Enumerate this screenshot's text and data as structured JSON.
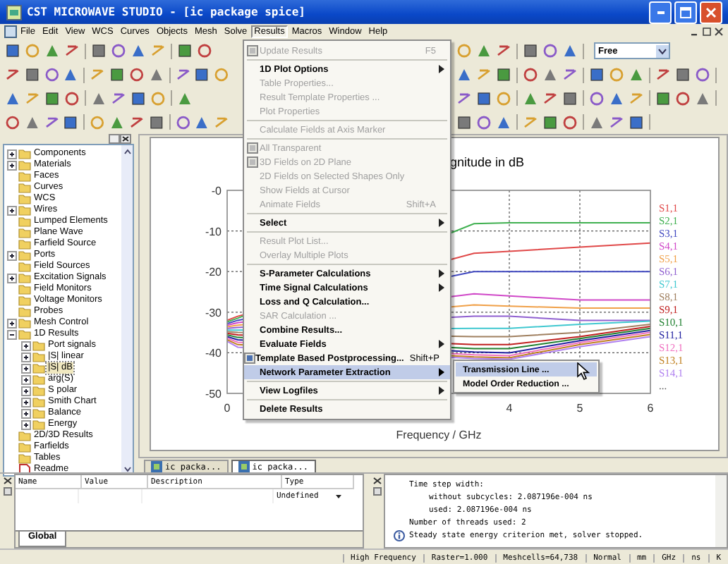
{
  "window": {
    "title": "CST MICROWAVE STUDIO - [ic package spice]"
  },
  "menu_bar": [
    {
      "label": "File",
      "selected": false
    },
    {
      "label": "Edit",
      "selected": false
    },
    {
      "label": "View",
      "selected": false
    },
    {
      "label": "WCS",
      "selected": false
    },
    {
      "label": "Curves",
      "selected": false
    },
    {
      "label": "Objects",
      "selected": false
    },
    {
      "label": "Mesh",
      "selected": false
    },
    {
      "label": "Solve",
      "selected": false
    },
    {
      "label": "Results",
      "selected": true
    },
    {
      "label": "Macros",
      "selected": false
    },
    {
      "label": "Window",
      "selected": false
    },
    {
      "label": "Help",
      "selected": false
    }
  ],
  "toolbar": {
    "mode_combo": {
      "value": "Free"
    }
  },
  "tree": [
    {
      "label": "Components",
      "kind": "folder",
      "expanded": false,
      "selected": false
    },
    {
      "label": "Materials",
      "kind": "folder",
      "expanded": false,
      "selected": false
    },
    {
      "label": "Faces",
      "kind": "folder",
      "selected": false
    },
    {
      "label": "Curves",
      "kind": "folder",
      "selected": false
    },
    {
      "label": "WCS",
      "kind": "folder",
      "selected": false
    },
    {
      "label": "Wires",
      "kind": "folder",
      "expanded": false,
      "selected": false
    },
    {
      "label": "Lumped Elements",
      "kind": "folder",
      "selected": false
    },
    {
      "label": "Plane Wave",
      "kind": "folder",
      "selected": false
    },
    {
      "label": "Farfield Source",
      "kind": "folder",
      "selected": false
    },
    {
      "label": "Ports",
      "kind": "folder",
      "expanded": false,
      "selected": false
    },
    {
      "label": "Field Sources",
      "kind": "folder",
      "selected": false
    },
    {
      "label": "Excitation Signals",
      "kind": "folder",
      "expanded": false,
      "selected": false
    },
    {
      "label": "Field Monitors",
      "kind": "folder",
      "selected": false
    },
    {
      "label": "Voltage Monitors",
      "kind": "folder",
      "selected": false
    },
    {
      "label": "Probes",
      "kind": "folder",
      "selected": false
    },
    {
      "label": "Mesh Control",
      "kind": "folder",
      "expanded": false,
      "selected": false
    },
    {
      "label": "1D Results",
      "kind": "folder",
      "expanded": true,
      "selected": false,
      "children": [
        {
          "label": "Port signals",
          "kind": "folder",
          "expanded": false,
          "selected": false
        },
        {
          "label": "|S| linear",
          "kind": "folder",
          "expanded": false,
          "selected": false
        },
        {
          "label": "|S| dB",
          "kind": "folder",
          "expanded": false,
          "selected": true
        },
        {
          "label": "arg(S)",
          "kind": "folder",
          "expanded": false,
          "selected": false
        },
        {
          "label": "S polar",
          "kind": "folder",
          "expanded": false,
          "selected": false
        },
        {
          "label": "Smith Chart",
          "kind": "folder",
          "expanded": false,
          "selected": false
        },
        {
          "label": "Balance",
          "kind": "folder",
          "expanded": false,
          "selected": false
        },
        {
          "label": "Energy",
          "kind": "folder",
          "expanded": false,
          "selected": false
        }
      ]
    },
    {
      "label": "2D/3D Results",
      "kind": "folder",
      "selected": false
    },
    {
      "label": "Farfields",
      "kind": "folder",
      "selected": false
    },
    {
      "label": "Tables",
      "kind": "folder",
      "selected": false
    },
    {
      "label": "Readme",
      "kind": "file",
      "selected": false
    }
  ],
  "plot": {
    "title": "gnitude in dB",
    "legend_more": "...",
    "chart_data": {
      "type": "line",
      "xlabel": "Frequency / GHz",
      "grid": true,
      "x": [
        0,
        0.15,
        3.5,
        4,
        5,
        6
      ],
      "xlim": [
        0,
        6
      ],
      "ylim": [
        -50,
        0
      ],
      "xticks": [
        0,
        4,
        5,
        6
      ],
      "yticks": [
        {
          "value": 0,
          "label": "-0"
        },
        -10,
        -20,
        -30,
        -40,
        -50
      ],
      "series": [
        {
          "name": "S1,1",
          "color": "#e04848",
          "values": [
            -32,
            -31,
            -15.5,
            -15,
            -14,
            -13
          ]
        },
        {
          "name": "S2,1",
          "color": "#40b050",
          "values": [
            -32.4,
            -31.5,
            -8.2,
            -8,
            -8,
            -8
          ]
        },
        {
          "name": "S3,1",
          "color": "#4048c0",
          "values": [
            -32.8,
            -32,
            -20,
            -20,
            -20,
            -20
          ]
        },
        {
          "name": "S4,1",
          "color": "#d048c8",
          "values": [
            -33.2,
            -32.6,
            -25.5,
            -26,
            -27,
            -27
          ]
        },
        {
          "name": "S5,1",
          "color": "#f0a048",
          "values": [
            -33.6,
            -33.2,
            -28.2,
            -28.5,
            -29,
            -29
          ]
        },
        {
          "name": "S6,1",
          "color": "#9060d0",
          "values": [
            -34,
            -33.8,
            -31,
            -31,
            -32,
            -32
          ]
        },
        {
          "name": "S7,1",
          "color": "#40c8d0",
          "values": [
            -34.4,
            -34.4,
            -34,
            -34,
            -33,
            -32.2
          ]
        },
        {
          "name": "S8,1",
          "color": "#a08060",
          "values": [
            -34.8,
            -35,
            -36,
            -36,
            -35,
            -33
          ]
        },
        {
          "name": "S9,1",
          "color": "#c02020",
          "values": [
            -35.2,
            -35.6,
            -38,
            -38,
            -36,
            -33.5
          ]
        },
        {
          "name": "S10,1",
          "color": "#208030",
          "values": [
            -35.6,
            -36.2,
            -39,
            -39,
            -36.5,
            -34
          ]
        },
        {
          "name": "S11,1",
          "color": "#2020a0",
          "values": [
            -36,
            -36.8,
            -39.8,
            -40,
            -37,
            -34.5
          ]
        },
        {
          "name": "S12,1",
          "color": "#f070c0",
          "values": [
            -36.4,
            -37.4,
            -40.5,
            -40.7,
            -37.5,
            -35
          ]
        },
        {
          "name": "S13,1",
          "color": "#c08020",
          "values": [
            -36.8,
            -38,
            -41,
            -41.2,
            -38,
            -35.5
          ]
        },
        {
          "name": "S14,1",
          "color": "#b080f0",
          "values": [
            -37.2,
            -38.6,
            -41.4,
            -41.6,
            -38.5,
            -36
          ]
        }
      ]
    }
  },
  "doc_tabs": [
    {
      "label": "ic packa...",
      "selected": false
    },
    {
      "label": "ic packa...",
      "selected": true
    }
  ],
  "menu": {
    "items": [
      {
        "kind": "item",
        "label": "Update Results",
        "shortcut": "F5",
        "icon": true,
        "disabled": true,
        "submenu": false,
        "selected": false
      },
      {
        "kind": "separator"
      },
      {
        "kind": "item",
        "label": "1D Plot Options",
        "disabled": false,
        "submenu": true,
        "selected": false
      },
      {
        "kind": "item",
        "label": "Table Properties...",
        "disabled": true,
        "submenu": false,
        "selected": false
      },
      {
        "kind": "item",
        "label": "Result Template Properties ...",
        "disabled": true,
        "submenu": false,
        "selected": false
      },
      {
        "kind": "item",
        "label": "Plot Properties",
        "disabled": true,
        "submenu": false,
        "selected": false
      },
      {
        "kind": "separator"
      },
      {
        "kind": "item",
        "label": "Calculate Fields at Axis Marker",
        "disabled": true,
        "submenu": false,
        "selected": false
      },
      {
        "kind": "separator"
      },
      {
        "kind": "item",
        "label": "All Transparent",
        "icon": true,
        "disabled": true,
        "submenu": false,
        "selected": false
      },
      {
        "kind": "item",
        "label": "3D Fields on 2D Plane",
        "icon": true,
        "disabled": true,
        "submenu": false,
        "selected": false
      },
      {
        "kind": "item",
        "label": "2D Fields on Selected Shapes Only",
        "disabled": true,
        "submenu": false,
        "selected": false
      },
      {
        "kind": "item",
        "label": "Show Fields at Cursor",
        "disabled": true,
        "submenu": false,
        "selected": false
      },
      {
        "kind": "item",
        "label": "Animate Fields",
        "shortcut": "Shift+A",
        "disabled": true,
        "submenu": false,
        "selected": false
      },
      {
        "kind": "separator"
      },
      {
        "kind": "item",
        "label": "Select",
        "disabled": false,
        "submenu": true,
        "selected": false
      },
      {
        "kind": "separator"
      },
      {
        "kind": "item",
        "label": "Result Plot List...",
        "disabled": true,
        "submenu": false,
        "selected": false
      },
      {
        "kind": "item",
        "label": "Overlay Multiple Plots",
        "disabled": true,
        "submenu": false,
        "selected": false
      },
      {
        "kind": "separator"
      },
      {
        "kind": "item",
        "label": "S-Parameter Calculations",
        "disabled": false,
        "submenu": true,
        "selected": false
      },
      {
        "kind": "item",
        "label": "Time Signal Calculations",
        "disabled": false,
        "submenu": true,
        "selected": false
      },
      {
        "kind": "item",
        "label": "Loss and Q Calculation...",
        "disabled": false,
        "submenu": false,
        "selected": false
      },
      {
        "kind": "item",
        "label": "SAR Calculation ...",
        "disabled": true,
        "submenu": false,
        "selected": false
      },
      {
        "kind": "item",
        "label": "Combine Results...",
        "disabled": false,
        "submenu": false,
        "selected": false
      },
      {
        "kind": "item",
        "label": "Evaluate Fields",
        "disabled": false,
        "submenu": true,
        "selected": false
      },
      {
        "kind": "item",
        "label": "Template Based Postprocessing...",
        "shortcut": "Shift+P",
        "icon": true,
        "disabled": false,
        "submenu": false,
        "selected": false
      },
      {
        "kind": "item",
        "label": "Network Parameter Extraction",
        "disabled": false,
        "submenu": true,
        "selected": true,
        "submenu_items": [
          {
            "label": "Transmission Line ...",
            "selected": true
          },
          {
            "label": "Model Order Reduction ...",
            "selected": false
          }
        ]
      },
      {
        "kind": "separator"
      },
      {
        "kind": "item",
        "label": "View Logfiles",
        "disabled": false,
        "submenu": true,
        "selected": false
      },
      {
        "kind": "separator"
      },
      {
        "kind": "item",
        "label": "Delete Results",
        "disabled": false,
        "submenu": false,
        "selected": false
      }
    ]
  },
  "parameters": {
    "columns": [
      "Name",
      "Value",
      "Description",
      "Type"
    ],
    "type_value": "Undefined",
    "tabs": [
      {
        "label": "Global",
        "selected": true
      }
    ]
  },
  "messages": [
    {
      "kind": "plain",
      "text": "Time step width:",
      "children": [
        {
          "kind": "plain",
          "text": "without subcycles: 2.087196e-004 ns"
        },
        {
          "kind": "plain",
          "text": "used: 2.087196e-004 ns"
        }
      ]
    },
    {
      "kind": "plain",
      "text": "Number of threads used: 2"
    },
    {
      "kind": "info",
      "text": "Steady state energy criterion met, solver stopped."
    }
  ],
  "status_bar": [
    "High Frequency",
    "Raster=1.000",
    "Meshcells=64,738",
    "Normal",
    "mm",
    "GHz",
    "ns",
    "K"
  ]
}
